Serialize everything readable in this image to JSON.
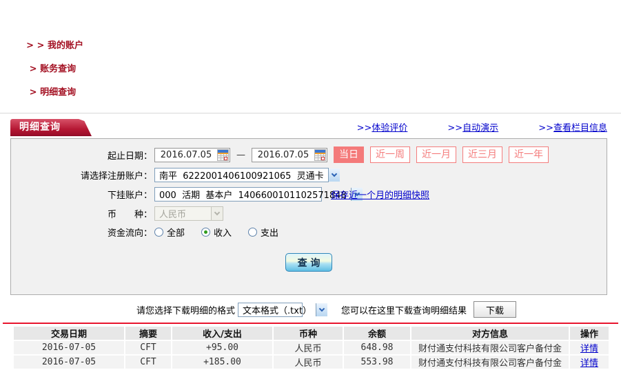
{
  "colors": {
    "brand_red": "#a31022",
    "tab_red": "#b51733",
    "link_blue": "#0000cc",
    "salmon": "#f47a7a",
    "amount_red": "#c50000",
    "divider_red": "#e8132c"
  },
  "breadcrumb": {
    "items": [
      {
        "sep": "> > ",
        "label": "我的账户"
      },
      {
        "sep": " > ",
        "label": "账务查询"
      },
      {
        "sep": " > ",
        "label": "明细查询"
      }
    ]
  },
  "tab": {
    "title": "明细查询"
  },
  "header_links": [
    {
      "prefix": ">>",
      "label": "体验评价"
    },
    {
      "prefix": ">>",
      "label": "自动演示"
    },
    {
      "prefix": ">>",
      "label": "查看栏目信息"
    }
  ],
  "form": {
    "date_range": {
      "label": "起止日期：",
      "start_value": "2016.07.05",
      "end_value": "2016.07.05",
      "separator": "—"
    },
    "quick_ranges": [
      {
        "label": "当日",
        "active": true
      },
      {
        "label": "近一周",
        "active": false
      },
      {
        "label": "近一月",
        "active": false
      },
      {
        "label": "近三月",
        "active": false
      },
      {
        "label": "近一年",
        "active": false
      }
    ],
    "registered_account": {
      "label": "请选择注册账户：",
      "value": "南平  6222001406100921065  灵通卡"
    },
    "sub_account": {
      "label": "下挂账户：",
      "value": "000  活期  基本户  1406600101102571848",
      "snapshot_link": "保存近一个月的明细快照"
    },
    "currency": {
      "label": "币　　种：",
      "value": "人民币"
    },
    "fund_flow": {
      "label": "资金流向：",
      "options": [
        {
          "label": "全部",
          "checked": false
        },
        {
          "label": "收入",
          "checked": true
        },
        {
          "label": "支出",
          "checked": false
        }
      ]
    },
    "query_button": "查 询"
  },
  "download": {
    "format_label": "请您选择下载明细的格式",
    "format_value": "文本格式（.txt）",
    "hint": "您可以在这里下载查询明细结果",
    "button": "下载"
  },
  "table": {
    "columns": [
      "交易日期",
      "摘要",
      "收入/支出",
      "币种",
      "余额",
      "对方信息",
      "操作"
    ],
    "rows": [
      {
        "date": "2016-07-05",
        "summary": "CFT",
        "amount": "+95.00",
        "currency": "人民币",
        "balance": "648.98",
        "counterparty": "财付通支付科技有限公司客户备付金",
        "action": "详情"
      },
      {
        "date": "2016-07-05",
        "summary": "CFT",
        "amount": "+185.00",
        "currency": "人民币",
        "balance": "553.98",
        "counterparty": "财付通支付科技有限公司客户备付金",
        "action": "详情"
      }
    ]
  }
}
